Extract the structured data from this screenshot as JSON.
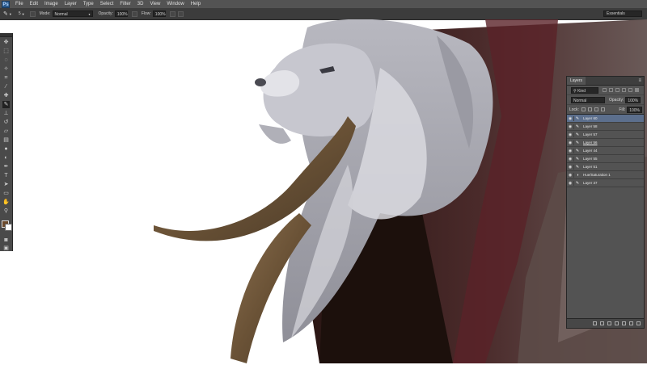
{
  "app": {
    "logo": "Ps"
  },
  "menu": [
    "File",
    "Edit",
    "Image",
    "Layer",
    "Type",
    "Select",
    "Filter",
    "3D",
    "View",
    "Window",
    "Help"
  ],
  "options": {
    "brush_size": "5",
    "mode_label": "Mode:",
    "mode_value": "Normal",
    "opacity_label": "Opacity:",
    "opacity_value": "100%",
    "flow_label": "Flow:",
    "flow_value": "100%",
    "workspace": "Essentials"
  },
  "layers_panel": {
    "tab": "Layers",
    "kind_filter": "Kind",
    "blend_mode": "Normal",
    "opacity_label": "Opacity:",
    "opacity_value": "100%",
    "lock_label": "Lock:",
    "fill_label": "Fill:",
    "fill_value": "100%",
    "layers": [
      {
        "name": "Layer 60",
        "selected": true
      },
      {
        "name": "Layer 58",
        "selected": false
      },
      {
        "name": "Layer 57",
        "selected": false
      },
      {
        "name": "Layer 56",
        "selected": false
      },
      {
        "name": "Layer 44",
        "selected": false
      },
      {
        "name": "Layer 55",
        "selected": false
      },
      {
        "name": "Layer 51",
        "selected": false
      },
      {
        "name": "Hue/Saturation 1",
        "selected": false
      },
      {
        "name": "Layer 37",
        "selected": false
      }
    ]
  },
  "colors": {
    "foreground": "#6b4a2c",
    "background": "#ffffff",
    "accent": "#5c6f8d"
  }
}
